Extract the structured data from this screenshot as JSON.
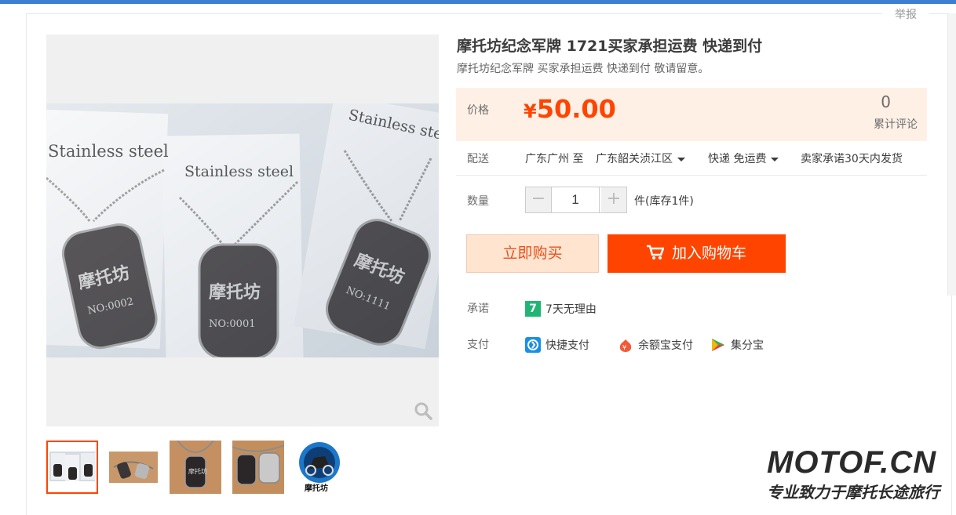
{
  "report_label": "举报",
  "product": {
    "title": "摩托坊纪念军牌 1721买家承担运费 快递到付",
    "subtitle": "摩托坊纪念军牌 买家承担运费 快递到付 敬请留意。"
  },
  "photo": {
    "card_texts": [
      "Stainless steel",
      "Stainless steel",
      "Stainless steel"
    ],
    "tag_texts": [
      {
        "brand": "摩托坊",
        "code": "NO:0002"
      },
      {
        "brand": "摩托坊",
        "code": "NO:0001"
      },
      {
        "brand": "摩托坊",
        "code": "NO:1111"
      }
    ]
  },
  "price": {
    "label": "价格",
    "currency": "¥",
    "value": "50.00",
    "color": "#ff4400",
    "review_count": "0",
    "review_label": "累计评论"
  },
  "shipping": {
    "label": "配送",
    "from": "广东广州 至",
    "to": "广东韶关浈江区",
    "method": "快递 免运费",
    "promise": "卖家承诺30天内发货"
  },
  "quantity": {
    "label": "数量",
    "value": "1",
    "minus": "−",
    "plus": "+",
    "stock": "件(库存1件)"
  },
  "actions": {
    "buy_now": "立即购买",
    "add_to_cart": "加入购物车"
  },
  "promise": {
    "label": "承诺",
    "item": "7天无理由",
    "badge": "7"
  },
  "payment": {
    "label": "支付",
    "methods": [
      "快捷支付",
      "余额宝支付",
      "集分宝"
    ]
  },
  "icons": [
    "zoom-icon",
    "cart-icon",
    "quick-pay-icon",
    "yuebao-icon",
    "jifenbao-icon"
  ],
  "thumb_logo_text": "摩托坊",
  "watermark": {
    "big": "MOTOF.CN",
    "small": "专业致力于摩托长途旅行"
  }
}
